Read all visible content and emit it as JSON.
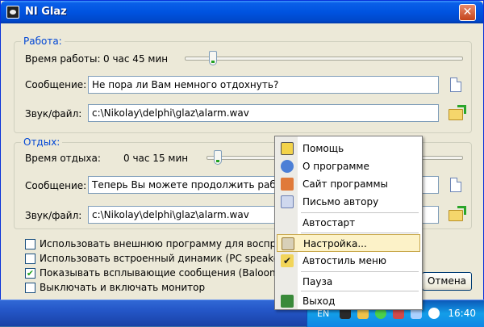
{
  "window": {
    "title": "NI Glaz",
    "close_glyph": "✕"
  },
  "work": {
    "group_label": "Работа:",
    "time_label": "Время работы:",
    "time_value": "0 час 45 мин",
    "slider_fraction": 0.09,
    "message_label": "Сообщение:",
    "message_value": "Не пора ли Вам немного отдохнуть?",
    "sound_label": "Звук/файл:",
    "sound_value": "c:\\Nikolay\\delphi\\glaz\\alarm.wav"
  },
  "rest": {
    "group_label": "Отдых:",
    "time_label": "Время отдыха:",
    "time_value": "0 час 15 мин",
    "slider_fraction": 0.03,
    "message_label": "Сообщение:",
    "message_value": "Теперь Вы можете продолжить работу.",
    "sound_label": "Звук/файл:",
    "sound_value": "c:\\Nikolay\\delphi\\glaz\\alarm.wav"
  },
  "options": [
    {
      "label": "Использовать внешнюю программу для воспроизвед",
      "checked": false
    },
    {
      "label": "Использовать встроенный динамик (PC speaker)",
      "checked": false
    },
    {
      "label": "Показывать всплывающие сообщения (Baloon Hints)",
      "checked": true
    },
    {
      "label": "Выключать и включать монитор",
      "checked": false
    }
  ],
  "check_glyph": "✔",
  "buttons": {
    "cancel": "Отмена"
  },
  "menu": {
    "items": [
      {
        "label": "Помощь",
        "icon": "help-icon"
      },
      {
        "label": "О программе",
        "icon": "info-icon"
      },
      {
        "label": "Сайт программы",
        "icon": "home-icon"
      },
      {
        "label": "Письмо автору",
        "icon": "mail-icon"
      },
      {
        "label": "Автостарт",
        "icon": ""
      },
      {
        "label": "Настройка...",
        "icon": "settings-tools-icon"
      },
      {
        "label": "Автостиль меню",
        "icon": "checkmark-icon"
      },
      {
        "label": "Пауза",
        "icon": ""
      },
      {
        "label": "Выход",
        "icon": "exit-icon"
      }
    ],
    "highlighted_index": 5
  },
  "taskbar": {
    "language": "EN",
    "clock": "16:40"
  },
  "colors": {
    "accent": "#0046d5",
    "titlebar": "#0053e0",
    "menu_highlight": "#fcf2c8",
    "checkmark": "#21a121"
  }
}
